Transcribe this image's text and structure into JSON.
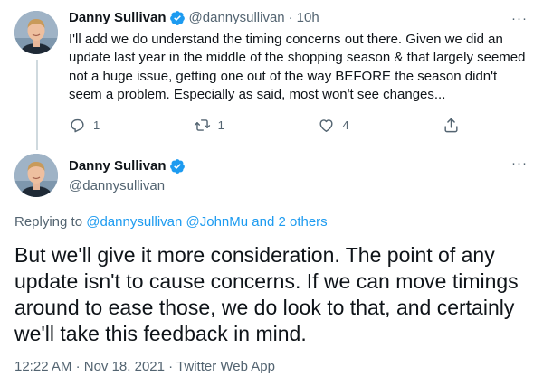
{
  "tweet1": {
    "author_name": "Danny Sullivan",
    "handle": "@dannysullivan",
    "separator": "·",
    "time": "10h",
    "text": "I'll add we do understand the timing concerns out there. Given we did an update last year in the middle of the shopping season & that largely seemed not a huge issue, getting one out of the way BEFORE the season didn't seem a problem. Especially as said, most won't see changes...",
    "actions": {
      "reply_count": "1",
      "retweet_count": "1",
      "like_count": "4"
    },
    "more_icon": "more-icon"
  },
  "tweet2": {
    "author_name": "Danny Sullivan",
    "handle": "@dannysullivan",
    "replying_prefix": "Replying to",
    "replying_user1": "@dannysullivan",
    "replying_user2": "@JohnMu",
    "replying_others": "and 2 others",
    "text": "But we'll give it more consideration. The point of any update isn't to cause concerns. If we can move timings around to ease those, we do look to that, and certainly we'll take this feedback in mind.",
    "time": "12:22 AM",
    "date": "Nov 18, 2021",
    "source": "Twitter Web App",
    "meta_separator": "·"
  },
  "colors": {
    "verified_blue": "#1d9bf0",
    "secondary_text": "#536471",
    "primary_text": "#0f1419",
    "link": "#1d9bf0"
  }
}
